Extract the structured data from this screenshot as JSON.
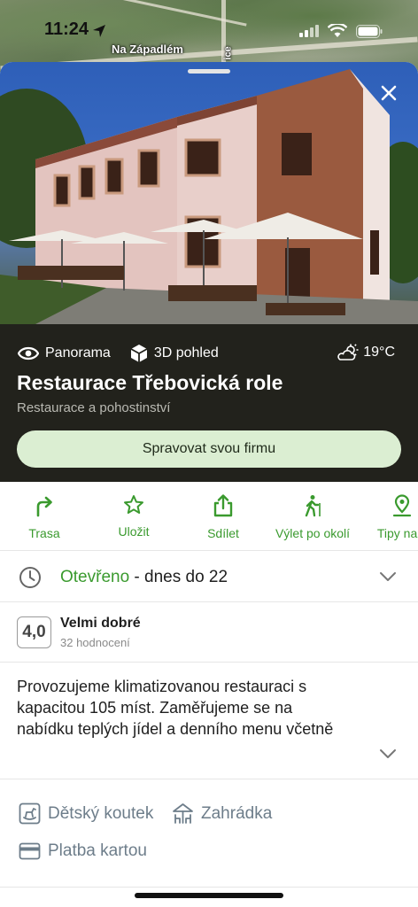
{
  "status_bar": {
    "time": "11:24"
  },
  "map": {
    "label_street": "Na Západlém",
    "label_side": "ice"
  },
  "place": {
    "chips": {
      "panorama": "Panorama",
      "view3d": "3D pohled"
    },
    "weather": "19°C",
    "name": "Restaurace Třebovická role",
    "category": "Restaurace a pohostinství",
    "manage_button": "Spravovat svou firmu"
  },
  "actions": {
    "route": "Trasa",
    "save": "Uložit",
    "share": "Sdílet",
    "trip": "Výlet po okolí",
    "tips": "Tipy na v"
  },
  "hours": {
    "status": "Otevřeno",
    "detail": " - dnes do 22"
  },
  "rating": {
    "score": "4,0",
    "label": "Velmi dobré",
    "count": "32 hodnocení"
  },
  "description": "Provozujeme klimatizovanou restauraci s kapacitou 105 míst. Zaměřujeme se na nabídku teplých jídel a denního menu včetně",
  "features": {
    "kids_corner": "Dětský koutek",
    "garden": "Zahrádka",
    "card_payment": "Platba kartou"
  },
  "colors": {
    "accent_green": "#3a9a2e",
    "dark_panel": "#22221c",
    "button_bg": "#dbeed2"
  }
}
